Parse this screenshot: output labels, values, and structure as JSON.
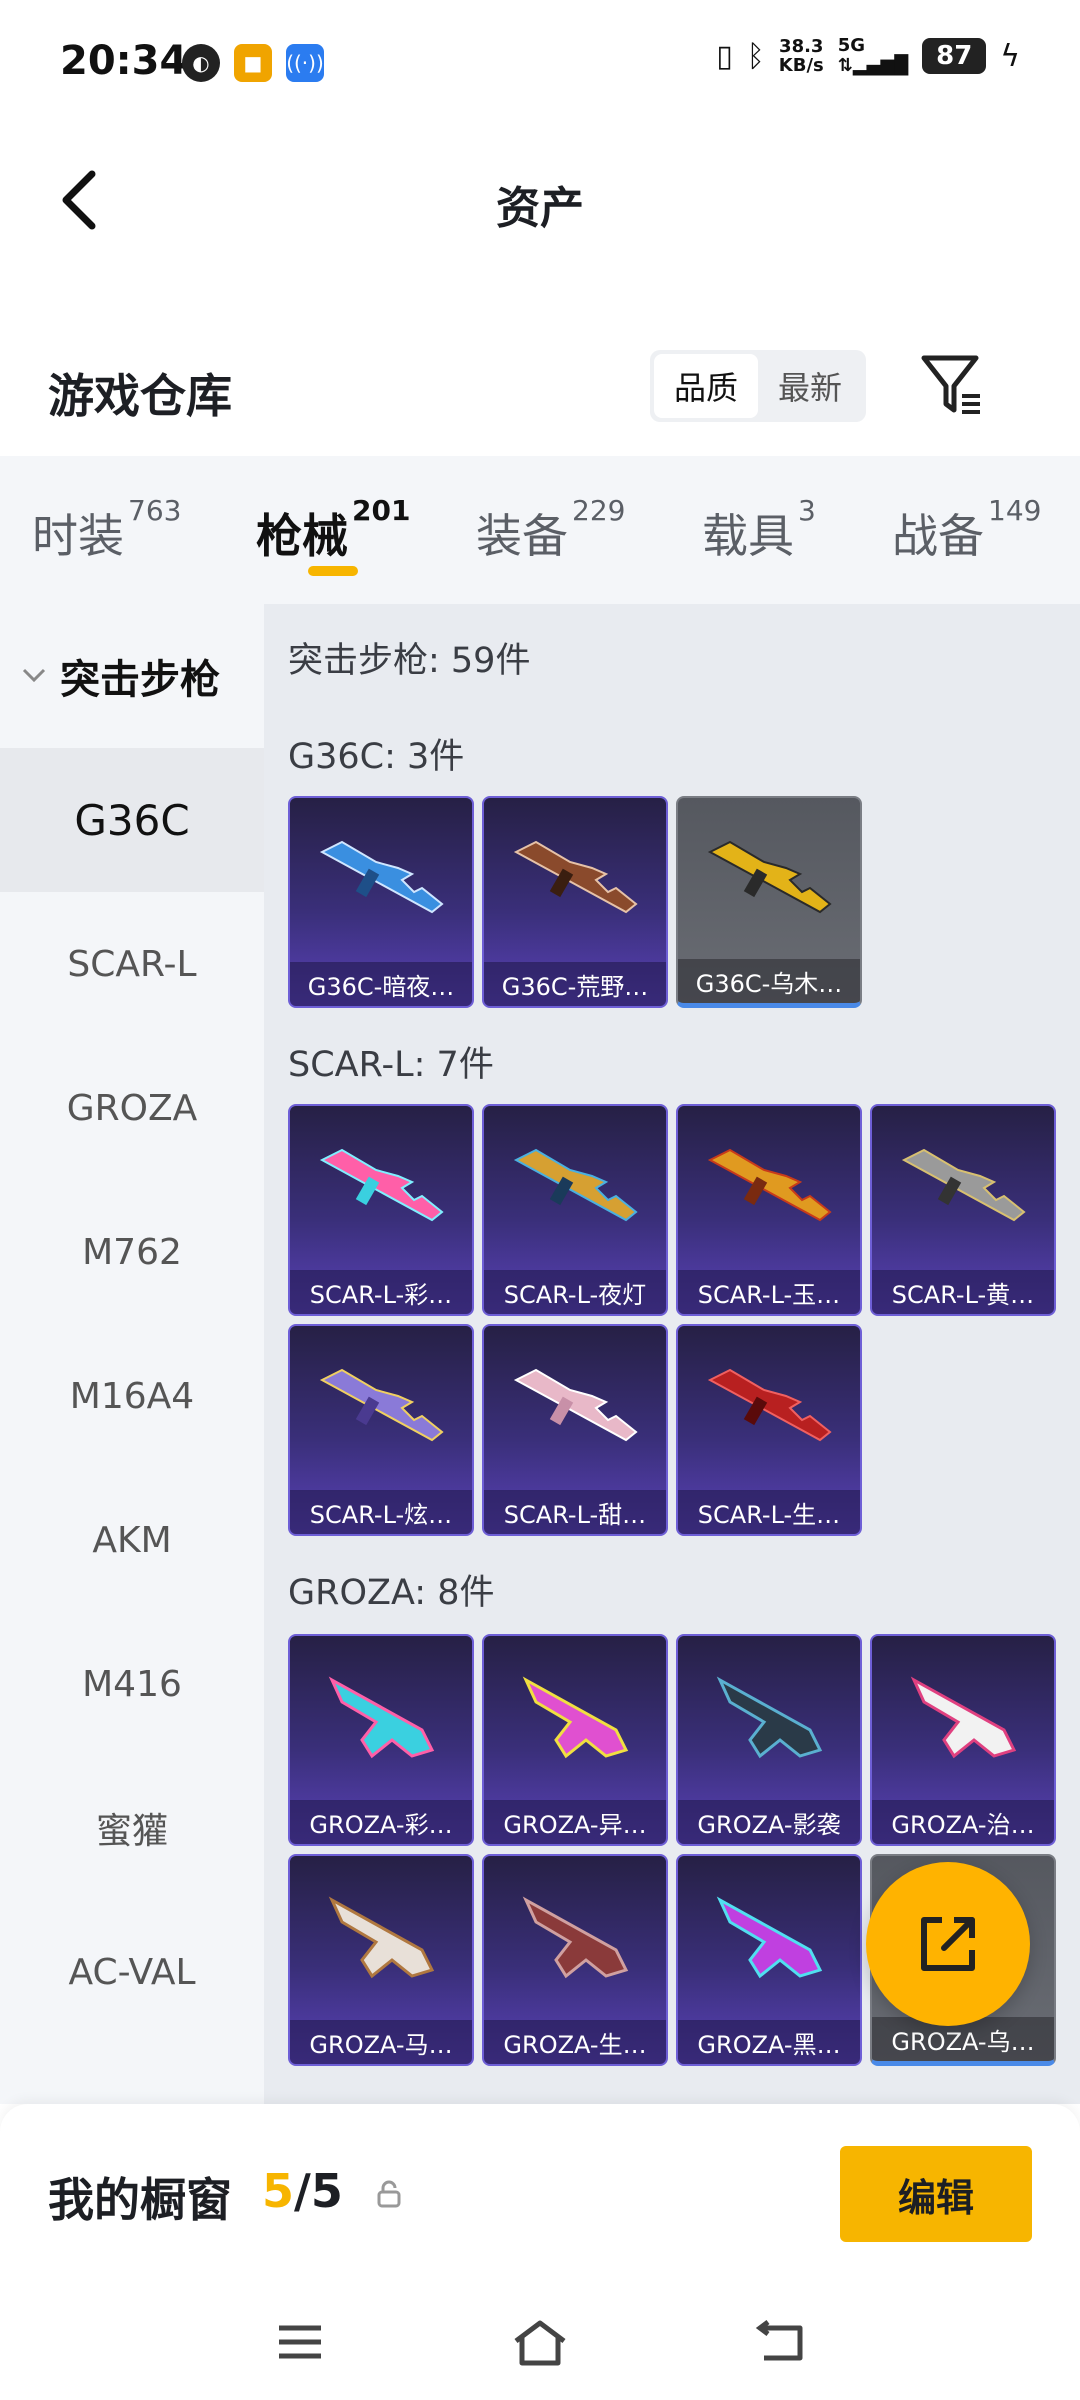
{
  "status_bar": {
    "time": "20:34",
    "speed_value": "38.3",
    "speed_unit": "KB/s",
    "network": "5G",
    "battery": "87"
  },
  "header": {
    "title": "资产"
  },
  "warehouse": {
    "title": "游戏仓库",
    "sort_options": [
      "品质",
      "最新"
    ],
    "active_sort": "品质"
  },
  "tabs": [
    {
      "label": "时装",
      "count": "763"
    },
    {
      "label": "枪械",
      "count": "201",
      "active": true
    },
    {
      "label": "装备",
      "count": "229"
    },
    {
      "label": "载具",
      "count": "3"
    },
    {
      "label": "战备",
      "count": "149"
    }
  ],
  "sidebar": {
    "category": "突击步枪",
    "items": [
      "G36C",
      "SCAR-L",
      "GROZA",
      "M762",
      "M16A4",
      "AKM",
      "M416",
      "蜜獾",
      "AC-VAL"
    ],
    "active": "G36C"
  },
  "content": {
    "category_title": "突击步枪: 59件",
    "groups": [
      {
        "title": "G36C: 3件",
        "items": [
          "G36C-暗夜…",
          "G36C-荒野…",
          "G36C-乌木…"
        ]
      },
      {
        "title": "SCAR-L: 7件",
        "items": [
          "SCAR-L-彩…",
          "SCAR-L-夜灯",
          "SCAR-L-玉…",
          "SCAR-L-黄…",
          "SCAR-L-炫…",
          "SCAR-L-甜…",
          "SCAR-L-生…"
        ]
      },
      {
        "title": "GROZA: 8件",
        "items": [
          "GROZA-彩…",
          "GROZA-异…",
          "GROZA-影袭",
          "GROZA-治…",
          "GROZA-马…",
          "GROZA-生…",
          "GROZA-黑…",
          "GROZA-乌…"
        ]
      }
    ]
  },
  "showcase": {
    "title": "我的橱窗",
    "current": "5",
    "total": "/5",
    "edit_label": "编辑"
  },
  "colors": {
    "accent": "#f7b500",
    "card_purple": "#3a2f7a"
  }
}
